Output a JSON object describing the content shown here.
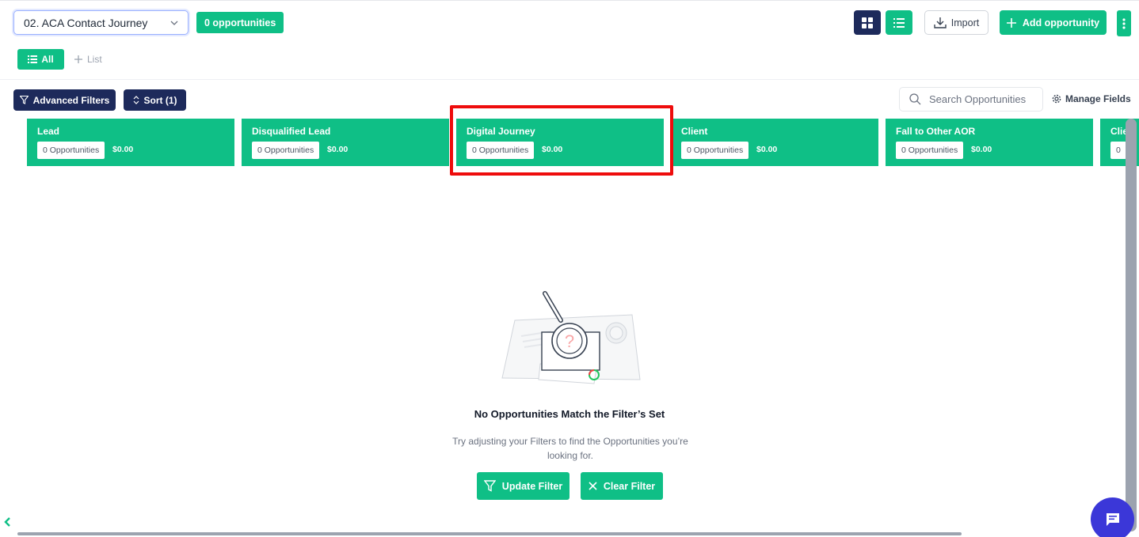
{
  "header": {
    "pipeline_value": "02. ACA Contact Journey",
    "opportunity_count": "0 opportunities",
    "import_label": "Import",
    "add_label": "Add opportunity"
  },
  "tabs": {
    "all_label": "All",
    "list_label": "List"
  },
  "filters": {
    "advanced_label": "Advanced Filters",
    "sort_label": "Sort (1)",
    "search_placeholder": "Search Opportunities",
    "manage_fields_label": "Manage Fields"
  },
  "stages": [
    {
      "name": "Lead",
      "count": "0 Opportunities",
      "amount": "$0.00"
    },
    {
      "name": "Disqualified Lead",
      "count": "0 Opportunities",
      "amount": "$0.00"
    },
    {
      "name": "Digital Journey",
      "count": "0 Opportunities",
      "amount": "$0.00"
    },
    {
      "name": "Client",
      "count": "0 Opportunities",
      "amount": "$0.00"
    },
    {
      "name": "Fall to Other AOR",
      "count": "0 Opportunities",
      "amount": "$0.00"
    },
    {
      "name": "Clie",
      "count": "0",
      "amount": ""
    }
  ],
  "empty_state": {
    "title": "No Opportunities Match the Filter’s Set",
    "description": "Try adjusting your Filters to find the Opportunities you’re looking for.",
    "update_label": "Update Filter",
    "clear_label": "Clear Filter"
  },
  "colors": {
    "accent_green": "#0fbf86",
    "navy": "#1d2a5b",
    "highlight_red": "#ee0c0c",
    "chat_purple": "#3b37d8"
  }
}
